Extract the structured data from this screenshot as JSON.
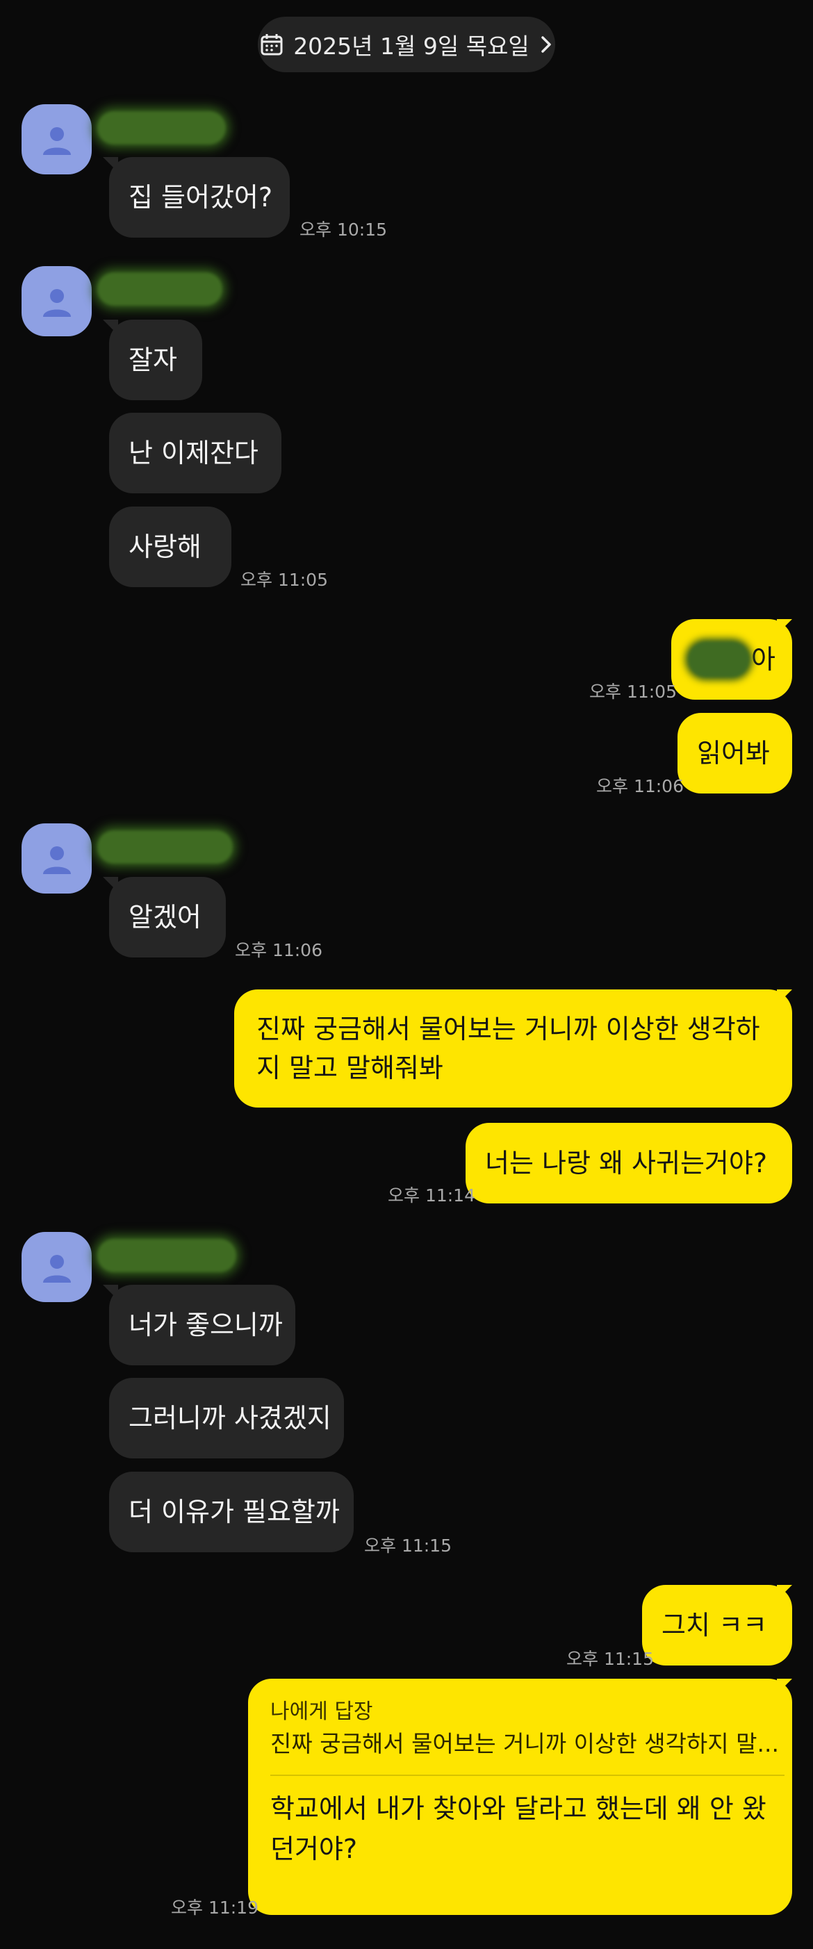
{
  "date_header": {
    "label": "2025년 1월 9일 목요일",
    "icon": "calendar-icon",
    "chevron": "chevron-right-icon"
  },
  "messages": [
    {
      "text": "집 들어갔어?",
      "time": "오후 10:15"
    },
    {
      "text": "잘자"
    },
    {
      "text": "난 이제잔다"
    },
    {
      "text": "사랑해",
      "time": "오후 11:05"
    },
    {
      "text": "아",
      "time": "오후 11:05"
    },
    {
      "text": "읽어봐",
      "time": "오후 11:06"
    },
    {
      "text": "알겠어",
      "time": "오후 11:06"
    },
    {
      "text": "진짜 궁금해서 물어보는 거니까 이상한 생각하지 말고 말해줘봐"
    },
    {
      "text": "너는 나랑 왜 사귀는거야?",
      "time": "오후 11:14"
    },
    {
      "text": "너가 좋으니까"
    },
    {
      "text": "그러니까 사겼겠지"
    },
    {
      "text": "더 이유가 필요할까",
      "time": "오후 11:15"
    },
    {
      "text": "그치 ㅋㅋ",
      "time": "오후 11:15"
    }
  ],
  "reply": {
    "header": "나에게 답장",
    "quoted": "진짜 궁금해서 물어보는 거니까 이상한 생각하지 말...",
    "text": "학교에서 내가 찾아와 달라고 했는데 왜 안 왔던거야?",
    "time": "오후 11:19"
  },
  "colors": {
    "background": "#0a0a0a",
    "incoming_bubble": "#262626",
    "outgoing_bubble": "#fee500",
    "avatar": "#8ea0e3"
  }
}
